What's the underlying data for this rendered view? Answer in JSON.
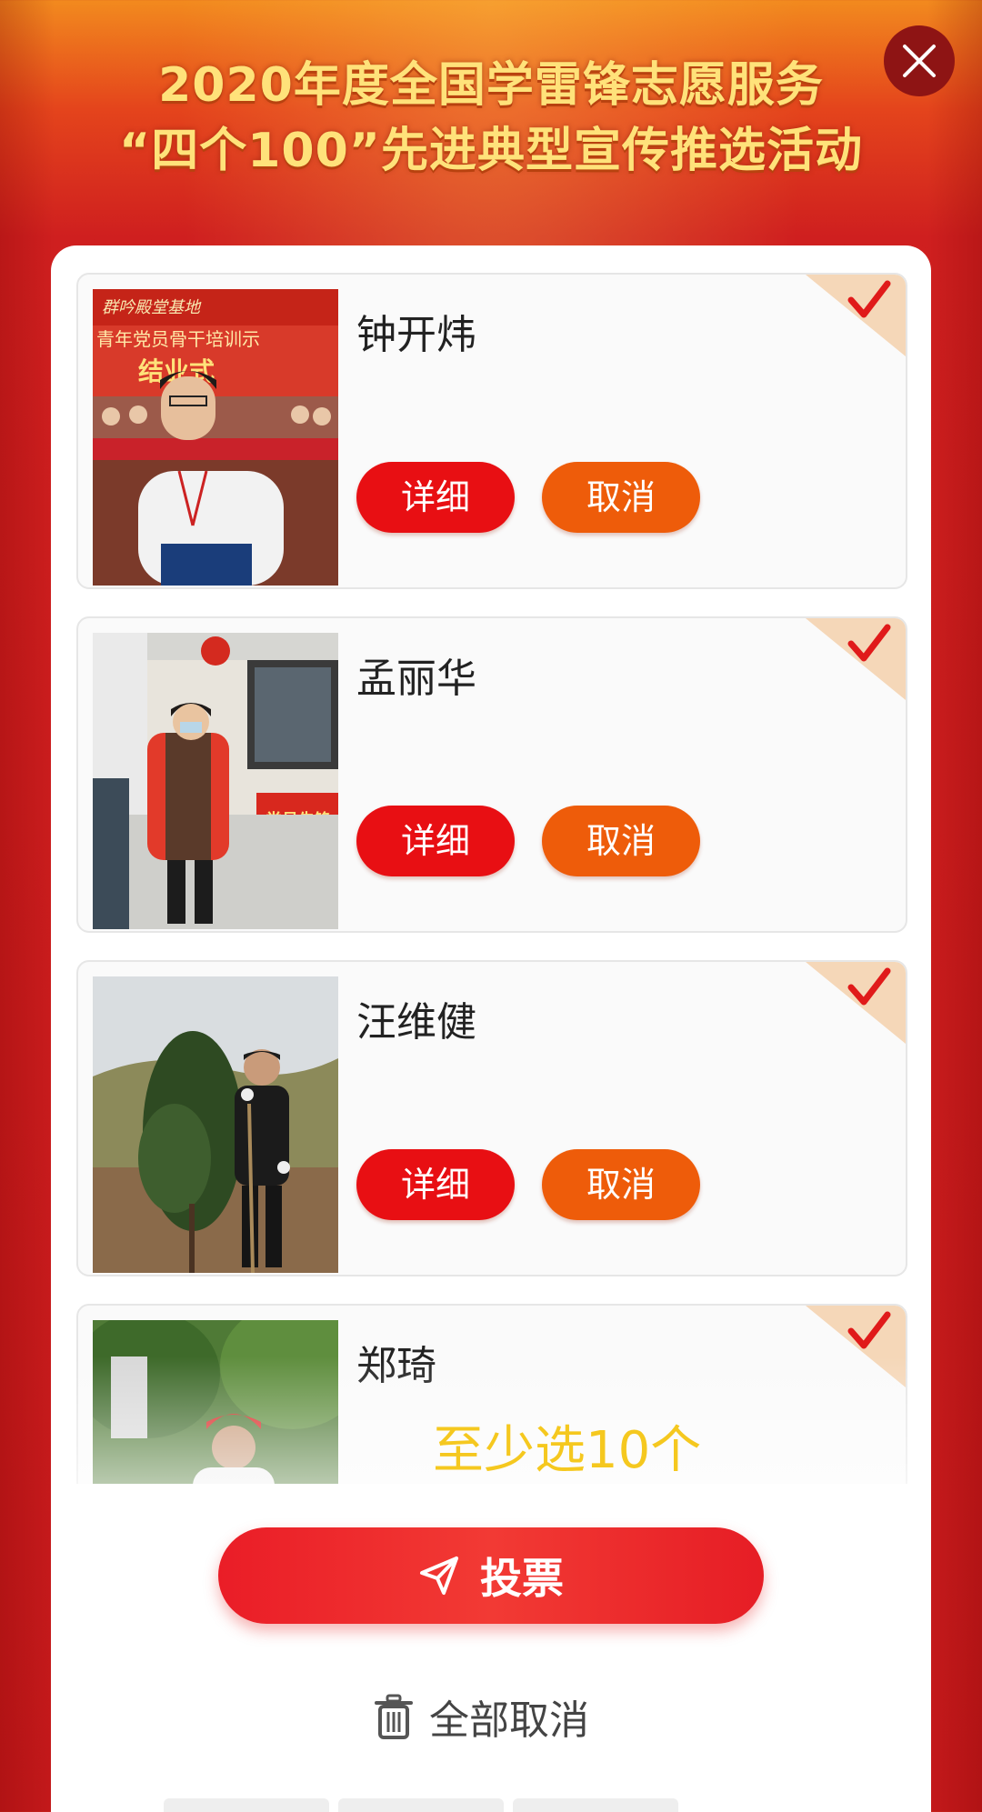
{
  "header": {
    "title_line1": "2020年度全国学雷锋志愿服务",
    "title_line2": "“四个100”先进典型宣传推选活动"
  },
  "candidates": [
    {
      "name": "钟开炜",
      "detail_label": "详细",
      "cancel_label": "取消",
      "selected": true
    },
    {
      "name": "孟丽华",
      "detail_label": "详细",
      "cancel_label": "取消",
      "selected": true
    },
    {
      "name": "汪维健",
      "detail_label": "详细",
      "cancel_label": "取消",
      "selected": true
    },
    {
      "name": "郑琦",
      "selected": true
    }
  ],
  "photo1_text": {
    "banner_top": "群吟殿堂基地",
    "banner_mid": "青年党员骨干培训示",
    "banner_main": "结业式"
  },
  "photo2_text": {
    "sign": "党员先锋"
  },
  "hint": "至少选10个",
  "vote": {
    "label": "投票"
  },
  "cancel_all": {
    "label": "全部取消"
  },
  "icons": {
    "close": "close-icon",
    "vote": "send-icon",
    "cancel_all": "trash-icon",
    "selected": "checkmark-icon"
  },
  "colors": {
    "detail_button": "#e80f13",
    "cancel_button": "#ee5c0a",
    "vote_button": "#ea1d27",
    "hint": "#f5c81f",
    "title": "#ffe27a"
  }
}
